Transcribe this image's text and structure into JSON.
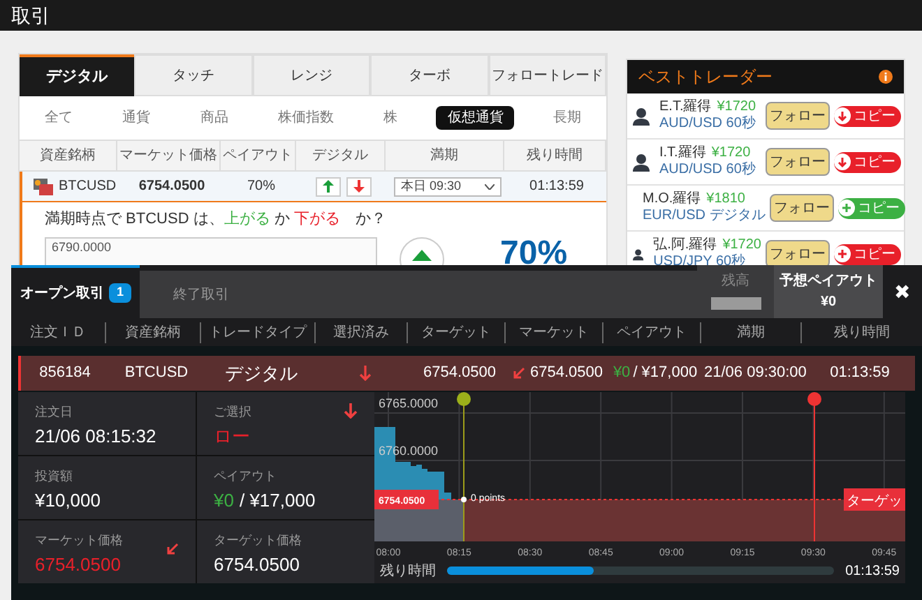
{
  "page_title": "取引",
  "trade_card": {
    "tabs": [
      {
        "label": "デジタル",
        "selected": true
      },
      {
        "label": "タッチ",
        "selected": false
      },
      {
        "label": "レンジ",
        "selected": false
      },
      {
        "label": "ターボ",
        "selected": false
      },
      {
        "label": "フォロートレード",
        "selected": false
      }
    ],
    "filters": [
      {
        "label": "全て",
        "selected": false
      },
      {
        "label": "通貨",
        "selected": false
      },
      {
        "label": "商品",
        "selected": false
      },
      {
        "label": "株価指数",
        "selected": false
      },
      {
        "label": "株",
        "selected": false
      },
      {
        "label": "仮想通貨",
        "selected": true
      },
      {
        "label": "長期",
        "selected": false
      }
    ],
    "columns": [
      "資産銘柄",
      "マーケット価格",
      "ペイアウト",
      "デジタル",
      "満期",
      "残り時間"
    ],
    "asset_row": {
      "asset": "BTCUSD",
      "price": "6754.0500",
      "payout": "70%",
      "expiry": "本日 09:30",
      "remaining": "01:13:59"
    },
    "question": [
      {
        "text": "満期時点で BTCUSD は、",
        "kind": "plain"
      },
      {
        "text": "上がる",
        "kind": "up"
      },
      {
        "text": " か ",
        "kind": "plain"
      },
      {
        "text": "下がる",
        "kind": "down"
      },
      {
        "text": "　か？",
        "kind": "plain"
      }
    ],
    "mini_chart_label": "6790.0000",
    "payout_big": "70%"
  },
  "best_traders": {
    "title": "ベストトレーダー",
    "traders": [
      {
        "name": "E.T.羅得",
        "amount": "¥1720",
        "instrument": "AUD/USD 60秒",
        "follow": "フォロー",
        "copy": "コピー",
        "kind": "down",
        "color": "#e8202a"
      },
      {
        "name": "I.T.羅得",
        "amount": "¥1720",
        "instrument": "AUD/USD 60秒",
        "follow": "フォロー",
        "copy": "コピー",
        "kind": "down",
        "color": "#e8202a"
      },
      {
        "name": "M.O.羅得",
        "amount": "¥1810",
        "instrument": "EUR/USD デジタル",
        "follow": "フォロー",
        "copy": "コピー",
        "kind": "plus",
        "color": "#3cb043"
      },
      {
        "name": "弘.阿.羅得",
        "amount": "¥1720",
        "instrument": "USD/JPY 60秒",
        "follow": "フォロー",
        "copy": "コピー",
        "kind": "plus",
        "color": "#e8202a"
      }
    ]
  },
  "open_trades": {
    "tabs": [
      {
        "label": "オープン取引",
        "badge": "1",
        "selected": true
      },
      {
        "label": "終了取引",
        "selected": false
      }
    ],
    "balance_label": "残高",
    "expected_payout_label": "予想ペイアウト",
    "expected_payout": "¥0",
    "close": "✖",
    "columns": [
      "注文ＩＤ",
      "資産銘柄",
      "トレードタイプ",
      "選択済み",
      "ターゲット",
      "マーケット",
      "ペイアウト",
      "満期",
      "残り時間"
    ],
    "trade": {
      "id": "856184",
      "asset": "BTCUSD",
      "type": "デジタル",
      "target": "6754.0500",
      "market": "6754.0500",
      "payout_won": "¥0",
      "payout_total": "/ ¥17,000",
      "expiry": "21/06 09:30:00",
      "remaining": "01:13:59"
    },
    "details": [
      {
        "label": "注文日",
        "value": "21/06 08:15:32",
        "kind": "plain"
      },
      {
        "label": "ご選択",
        "value": "ロー",
        "kind": "choice"
      },
      {
        "label": "投資額",
        "value": "¥10,000",
        "kind": "plain"
      },
      {
        "label": "ペイアウト",
        "value": "¥0",
        "value_2": "/ ¥17,000",
        "kind": "payout"
      },
      {
        "label": "マーケット価格",
        "value": "6754.0500",
        "kind": "market"
      },
      {
        "label": "ターゲット価格",
        "value": "6754.0500",
        "kind": "plain"
      }
    ],
    "chart": {
      "y_labels": [
        "6765.0000",
        "6760.0000"
      ],
      "x_labels": [
        "08:00",
        "08:15",
        "08:30",
        "08:45",
        "09:00",
        "09:15",
        "09:30",
        "09:45"
      ],
      "price_tag": "6754.0500",
      "points_label": "0 points",
      "target_tag": "ターゲッ"
    },
    "remaining": {
      "label": "残り時間",
      "level": 0.38,
      "value": "01:13:59"
    }
  }
}
